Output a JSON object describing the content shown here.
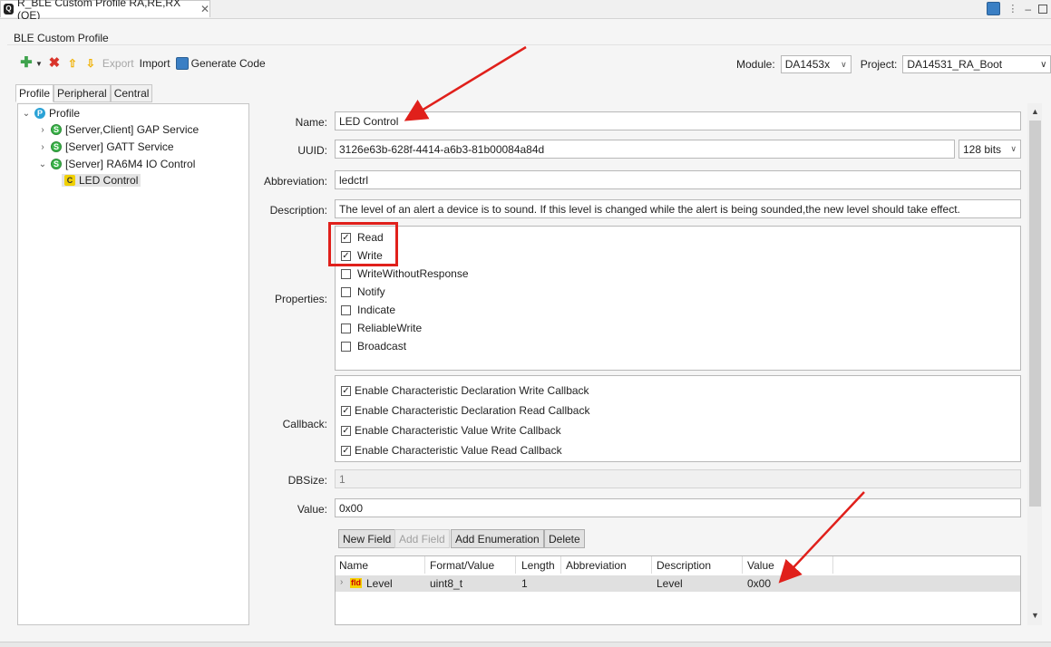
{
  "tab": {
    "title": "R_BLE Custom Profile RA,RE,RX (QE)",
    "close": "✕"
  },
  "page": {
    "title": "BLE Custom Profile"
  },
  "toolbar": {
    "export_label": "Export",
    "import_label": "Import",
    "generate_label": "Generate Code"
  },
  "module": {
    "label": "Module:",
    "value": "DA1453x"
  },
  "project": {
    "label": "Project:",
    "value": "DA14531_RA_Boot"
  },
  "profile_tabs": [
    "Profile",
    "Peripheral",
    "Central"
  ],
  "tree": {
    "root": {
      "badge": "P",
      "label": "Profile"
    },
    "items": [
      {
        "badge": "S",
        "label": "[Server,Client] GAP Service"
      },
      {
        "badge": "S",
        "label": "[Server] GATT Service"
      },
      {
        "badge": "S",
        "label": "[Server] RA6M4 IO Control"
      }
    ],
    "child": {
      "badge": "C",
      "label": "LED Control"
    }
  },
  "form": {
    "name_label": "Name:",
    "name_value": "LED Control",
    "uuid_label": "UUID:",
    "uuid_value": "3126e63b-628f-4414-a6b3-81b00084a84d",
    "uuid_bits": "128 bits",
    "abbr_label": "Abbreviation:",
    "abbr_value": "ledctrl",
    "desc_label": "Description:",
    "desc_value": "The level of an alert a device is to sound. If this level is changed while the alert is being sounded,the new level should take effect.",
    "properties_label": "Properties:",
    "properties": [
      {
        "label": "Read",
        "checked": true
      },
      {
        "label": "Write",
        "checked": true
      },
      {
        "label": "WriteWithoutResponse",
        "checked": false
      },
      {
        "label": "Notify",
        "checked": false
      },
      {
        "label": "Indicate",
        "checked": false
      },
      {
        "label": "ReliableWrite",
        "checked": false
      },
      {
        "label": "Broadcast",
        "checked": false
      }
    ],
    "callback_label": "Callback:",
    "callbacks": [
      {
        "label": "Enable Characteristic Declaration Write Callback",
        "checked": true
      },
      {
        "label": "Enable Characteristic Declaration Read Callback",
        "checked": true
      },
      {
        "label": "Enable Characteristic Value Write Callback",
        "checked": true
      },
      {
        "label": "Enable Characteristic Value Read Callback",
        "checked": true
      }
    ],
    "dbsize_label": "DBSize:",
    "dbsize_value": "1",
    "value_label": "Value:",
    "value_value": "0x00"
  },
  "field_buttons": {
    "new_field": "New Field",
    "add_field": "Add Field",
    "add_enum": "Add Enumeration",
    "delete": "Delete"
  },
  "table": {
    "headers": [
      "Name",
      "Format/Value",
      "Length",
      "Abbreviation",
      "Description",
      "Value"
    ],
    "row": {
      "icon": "fld",
      "name": "Level",
      "format": "uint8_t",
      "length": "1",
      "abbreviation": "",
      "description": "Level",
      "value": "0x00"
    }
  },
  "colors": {
    "annotation_red": "#e0201b",
    "selection_gray": "#e0e0e0"
  }
}
